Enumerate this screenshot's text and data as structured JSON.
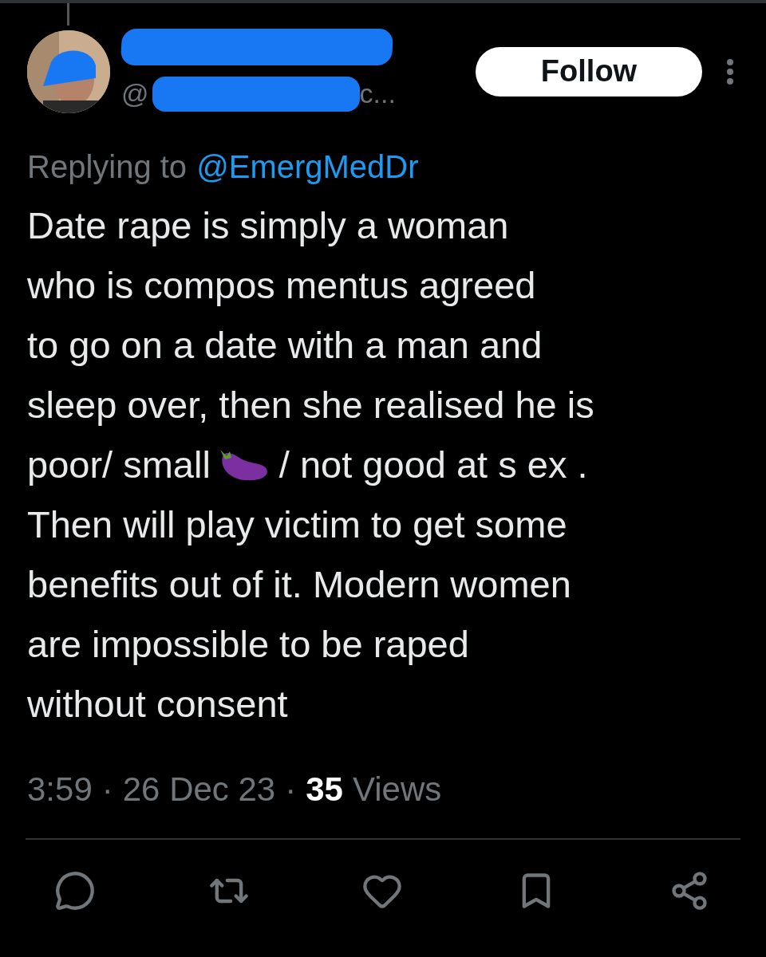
{
  "post": {
    "author": {
      "handle_prefix": "@",
      "handle_suffix": "c..."
    },
    "follow_button": "Follow",
    "replying_label": "Replying to",
    "replying_to": "@EmergMedDr",
    "body_lines": [
      [
        {
          "kind": "text",
          "text": "Date rape is simply a woman"
        }
      ],
      [
        {
          "kind": "text",
          "text": "who is compos mentus agreed"
        }
      ],
      [
        {
          "kind": "text",
          "text": "to go on a date with a man and"
        }
      ],
      [
        {
          "kind": "text",
          "text": "sleep over, then she realised he is"
        }
      ],
      [
        {
          "kind": "text",
          "text": "poor/ small"
        },
        {
          "kind": "icon"
        },
        {
          "kind": "text",
          "text": "/ not good at s ex ."
        }
      ],
      [
        {
          "kind": "text",
          "text": "Then will play victim to get some"
        }
      ],
      [
        {
          "kind": "text",
          "text": "benefits out of it. Modern women"
        }
      ],
      [
        {
          "kind": "text",
          "text": "are impossible to be raped"
        }
      ],
      [
        {
          "kind": "text",
          "text": "without consent"
        }
      ]
    ],
    "time": "3:59",
    "date": "26 Dec 23",
    "views_count": "35",
    "views_label": "Views",
    "separator": "·"
  }
}
